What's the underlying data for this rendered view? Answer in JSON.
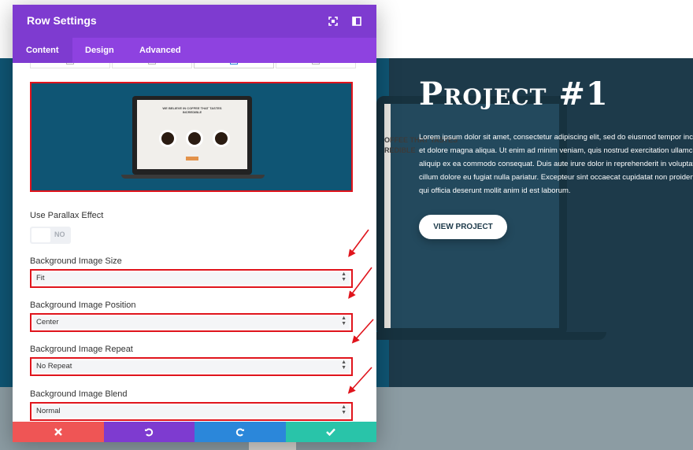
{
  "modal": {
    "title": "Row Settings",
    "header_icons": [
      "fullscreen-icon",
      "sidebar-icon"
    ],
    "tabs": [
      {
        "label": "Content",
        "active": true
      },
      {
        "label": "Design",
        "active": false
      },
      {
        "label": "Advanced",
        "active": false
      }
    ],
    "parallax": {
      "label": "Use Parallax Effect",
      "toggle_value": "NO"
    },
    "fields": [
      {
        "label": "Background Image Size",
        "value": "Fit"
      },
      {
        "label": "Background Image Position",
        "value": "Center"
      },
      {
        "label": "Background Image Repeat",
        "value": "No Repeat"
      },
      {
        "label": "Background Image Blend",
        "value": "Normal"
      }
    ],
    "footer": {
      "cancel_icon": "close-icon",
      "undo_icon": "undo-icon",
      "redo_icon": "redo-icon",
      "save_icon": "check-icon"
    },
    "preview_text": "WE BELIEVE IN COFFEE THAT TASTES INCREDIBLE"
  },
  "page": {
    "project_title": "Project #1",
    "project_text": "Lorem ipsum dolor sit amet, consectetur adipiscing elit, sed do eiusmod tempor incidi et dolore magna aliqua. Ut enim ad minim veniam, quis nostrud exercitation ullamco l aliquip ex ea commodo consequat. Duis aute irure dolor in reprehenderit in voluptate cillum dolore eu fugiat nulla pariatur. Excepteur sint occaecat cupidatat non proident, qui officia deserunt mollit anim id est laborum.",
    "button_label": "VIEW PROJECT",
    "laptop_text": "OFFEE THAT TASTES\nREDIBLE"
  },
  "colors": {
    "header": "#7e3bd0",
    "tabs": "#8e42e0",
    "highlight": "#e0141c",
    "cancel": "#ef5555",
    "undo": "#7e3bd0",
    "redo": "#2b87da",
    "save": "#29c4a9"
  }
}
